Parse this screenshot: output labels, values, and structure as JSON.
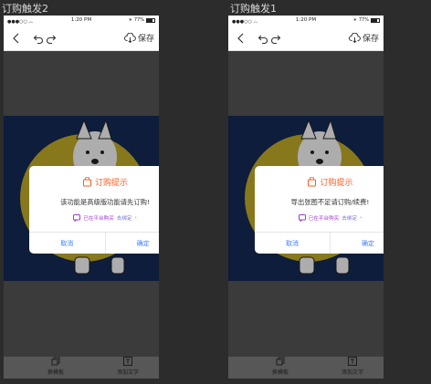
{
  "screens": [
    {
      "title": "订购触发2",
      "status": {
        "time": "1:20 PM",
        "battery": "77%"
      },
      "toolbar": {
        "save_label": "保存"
      },
      "dialog": {
        "title": "订购提示",
        "message": "该功能是高级版功能请先订购!",
        "note": "已在平台购买",
        "note_link": "去绑定",
        "cancel_label": "取消",
        "confirm_label": "确定"
      },
      "bottom": {
        "item1": "换模板",
        "item2": "添加文字"
      }
    },
    {
      "title": "订购触发1",
      "status": {
        "time": "1:20 PM",
        "battery": "77%"
      },
      "toolbar": {
        "save_label": "保存"
      },
      "dialog": {
        "title": "订购提示",
        "message": "导出张图不足请订购/续费!",
        "note": "已在平台购买",
        "note_link": "去绑定",
        "cancel_label": "取消",
        "confirm_label": "确定"
      },
      "bottom": {
        "item1": "换模板",
        "item2": "添加文字"
      }
    }
  ],
  "icons": {
    "back": "chevron-left-icon",
    "undo": "undo-icon",
    "redo": "redo-icon",
    "save": "cloud-download-icon",
    "dialog_title": "shopping-bag-icon",
    "note": "info-chat-icon",
    "template": "layers-icon",
    "text": "text-box-icon"
  },
  "colors": {
    "accent": "#ff5a1f",
    "link": "#3d7cff",
    "note": "#9b3bd4",
    "canvas_bg": "#142c58",
    "sun": "#c9b22a"
  }
}
